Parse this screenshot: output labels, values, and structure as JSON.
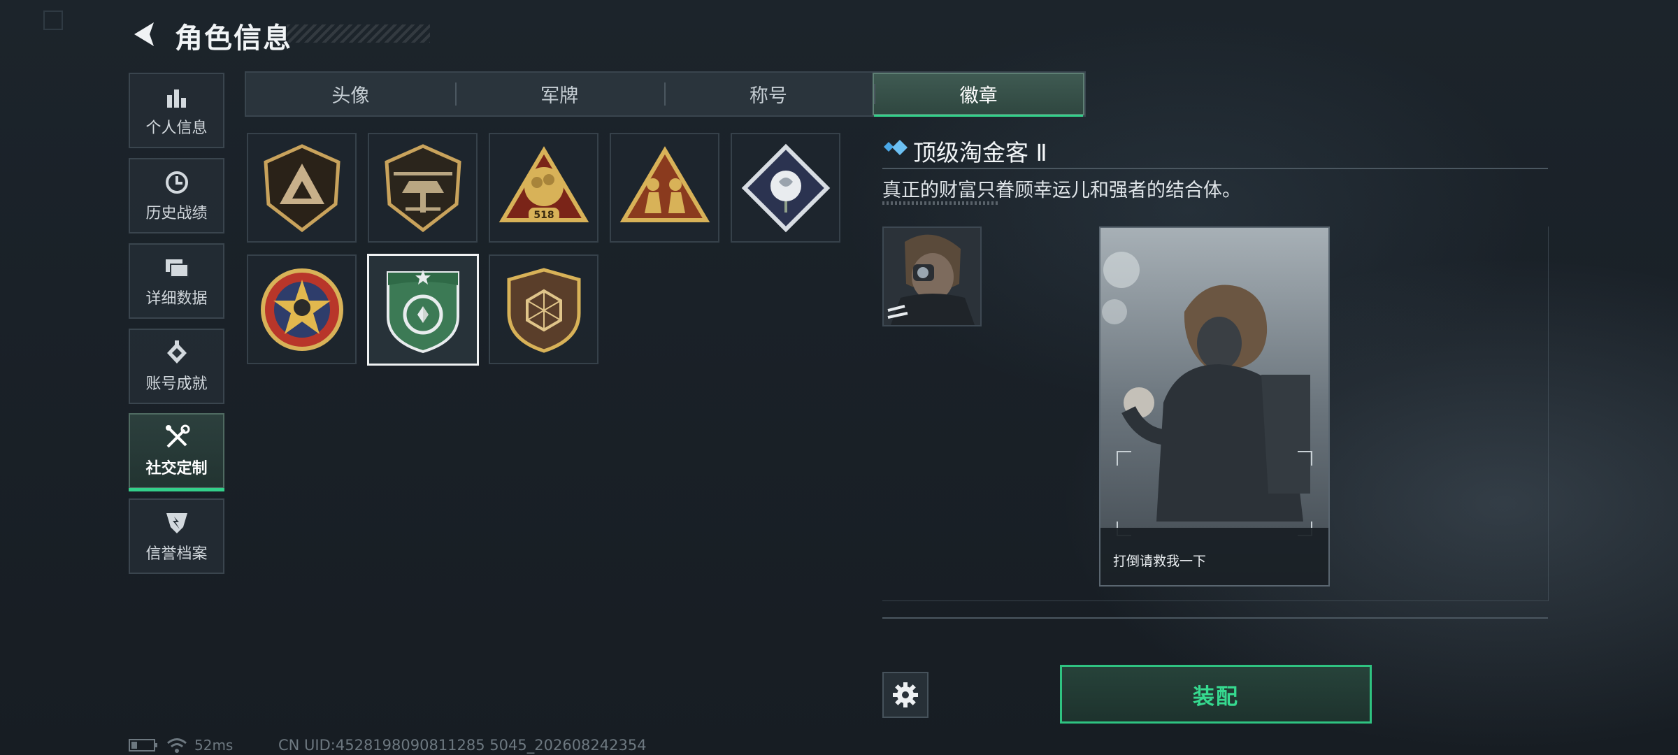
{
  "header": {
    "title": "角色信息"
  },
  "sidebar": {
    "items": [
      {
        "label": "个人信息",
        "icon": "bar-chart-icon"
      },
      {
        "label": "历史战绩",
        "icon": "history-clock-icon"
      },
      {
        "label": "详细数据",
        "icon": "folder-icon"
      },
      {
        "label": "账号成就",
        "icon": "achievement-icon"
      },
      {
        "label": "社交定制",
        "icon": "tools-icon",
        "active": true
      },
      {
        "label": "信誉档案",
        "icon": "reputation-shield-icon"
      }
    ]
  },
  "tabs": [
    {
      "label": "头像"
    },
    {
      "label": "军牌"
    },
    {
      "label": "称号"
    },
    {
      "label": "徽章",
      "active": true
    }
  ],
  "badges": {
    "items": [
      {
        "icon": "triangle-shield-badge-icon"
      },
      {
        "icon": "helicopter-badge-icon"
      },
      {
        "icon": "fist-518-badge-icon",
        "text": "518"
      },
      {
        "icon": "squad-triangle-badge-icon"
      },
      {
        "icon": "rose-diamond-badge-icon"
      },
      {
        "icon": "star-skull-roundel-badge-icon"
      },
      {
        "icon": "green-shield-badge-icon",
        "selected": true
      },
      {
        "icon": "hexagon-shield-badge-icon"
      }
    ]
  },
  "detail": {
    "title": "顶级淘金客 Ⅱ",
    "description": "真正的财富只眷顾幸运儿和强者的结合体。",
    "card_caption": "打倒请救我一下"
  },
  "actions": {
    "equip_label": "装配"
  },
  "status_bar": {
    "ping": "52ms",
    "uid": "CN UID:4528198090811285 5045_202608242354"
  },
  "colors": {
    "accent": "#33d08a",
    "background": "#1a2128"
  }
}
